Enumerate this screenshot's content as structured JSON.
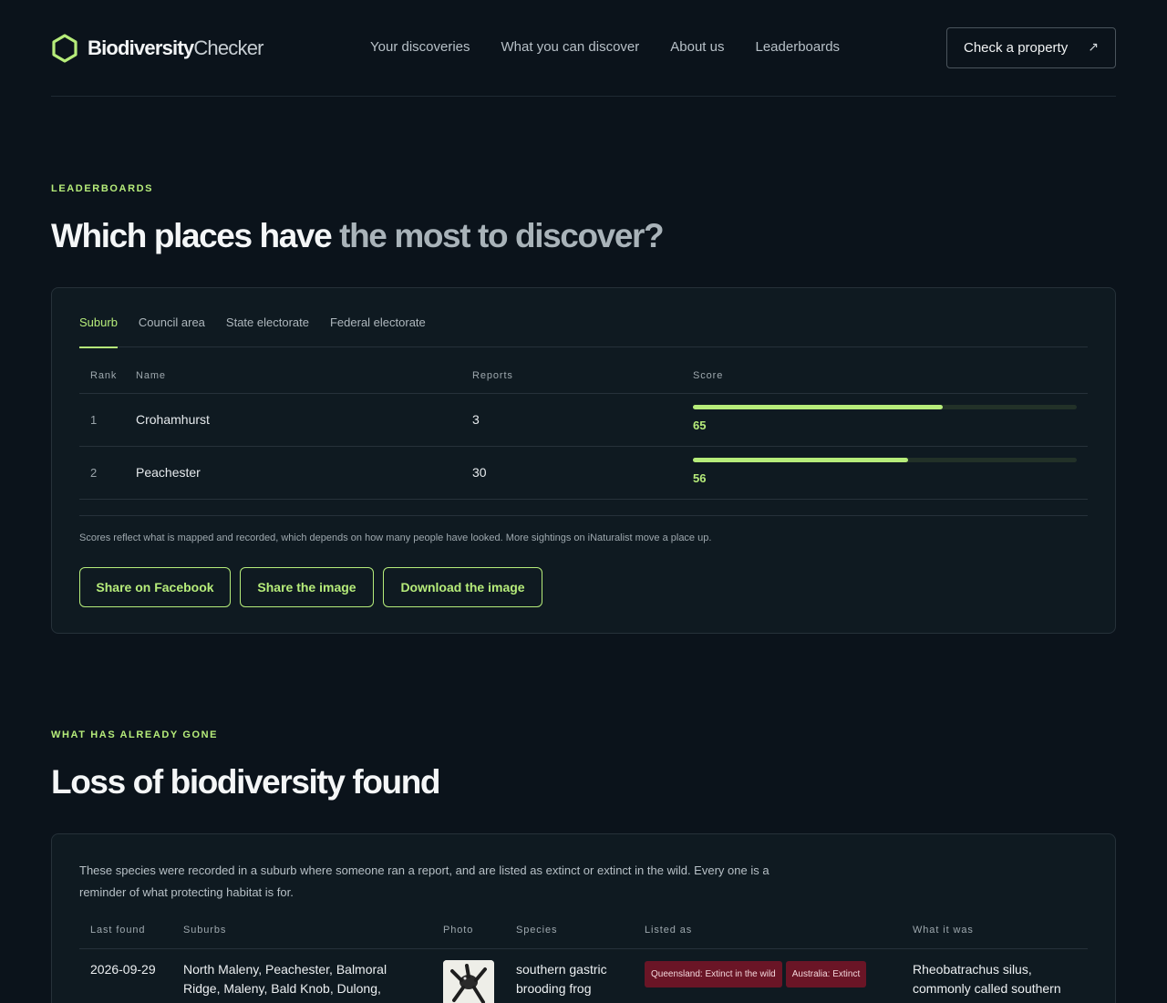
{
  "brand": {
    "bold": "Biodiversity",
    "light": "Checker",
    "accent": "#b6ec7a"
  },
  "nav": [
    "Your discoveries",
    "What you can discover",
    "About us",
    "Leaderboards"
  ],
  "cta": {
    "label": "Check a property",
    "icon": "arrow-up-right-icon",
    "glyph": "↗"
  },
  "leaderboards": {
    "eyebrow": "LEADERBOARDS",
    "title_strong": "Which places have",
    "title_muted": "the most to discover?",
    "tabs": [
      "Suburb",
      "Council area",
      "State electorate",
      "Federal electorate"
    ],
    "active_tab": "Suburb",
    "columns": {
      "rank": "Rank",
      "name": "Name",
      "reports": "Reports",
      "score": "Score"
    },
    "rows": [
      {
        "rank": "1",
        "name": "Crohamhurst",
        "reports": "3",
        "score": "65",
        "score_value": 65,
        "score_fill_fraction": 0.65
      },
      {
        "rank": "2",
        "name": "Peachester",
        "reports": "30",
        "score": "56",
        "score_value": 56,
        "score_fill_fraction": 0.56
      }
    ],
    "note": "Scores reflect what is mapped and recorded, which depends on how many people have looked. More sightings on iNaturalist move a place up.",
    "buttons": {
      "facebook": "Share on Facebook",
      "share": "Share the image",
      "download": "Download the image"
    }
  },
  "loss": {
    "eyebrow": "WHAT HAS ALREADY GONE",
    "title": "Loss of biodiversity found",
    "intro": "These species were recorded in a suburb where someone ran a report, and are listed as extinct or extinct in the wild. Every one is a reminder of what protecting habitat is for.",
    "columns": {
      "last_found": "Last found",
      "suburbs": "Suburbs",
      "photo": "Photo",
      "species": "Species",
      "listed_as": "Listed as",
      "what_it_was": "What it was"
    },
    "rows": [
      {
        "last_found": "2026-09-29",
        "suburbs": "North Maleny, Peachester, Balmoral Ridge, Maleny, Bald Knob, Dulong, Crohamhurst,",
        "photo_icon": "frog-photo",
        "species": "southern gastric brooding frog",
        "status_qld": "Queensland: Extinct in the wild",
        "status_aus": "Australia: Extinct",
        "status_color": "#6a1526",
        "what_it_was": "Rheobatrachus silus, commonly called southern"
      }
    ]
  }
}
